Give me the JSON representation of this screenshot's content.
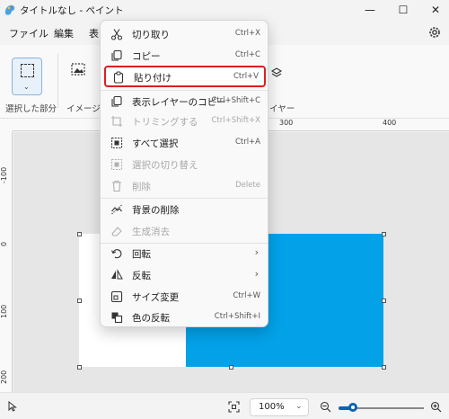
{
  "window": {
    "title": "タイトルなし - ペイント",
    "minimize": "—",
    "maximize": "☐",
    "close": "✕"
  },
  "menubar": {
    "items": [
      "ファイル",
      "編集",
      "表"
    ]
  },
  "ribbon": {
    "selection_label": "選択した部分",
    "image_label": "イメージ",
    "layers_label": "イヤー"
  },
  "rulers": {
    "top": [
      "300",
      "400"
    ],
    "left": [
      "-100",
      "0",
      "100",
      "200"
    ]
  },
  "context_menu": {
    "items": [
      {
        "label": "切り取り",
        "shortcut": "Ctrl+X",
        "icon": "scissors-icon",
        "enabled": true
      },
      {
        "label": "コピー",
        "shortcut": "Ctrl+C",
        "icon": "copy-icon",
        "enabled": true
      },
      {
        "label": "貼り付け",
        "shortcut": "Ctrl+V",
        "icon": "paste-icon",
        "enabled": true,
        "highlighted": true
      },
      {
        "label": "表示レイヤーのコピー",
        "shortcut": "Ctrl+Shift+C",
        "icon": "copy-layer-icon",
        "enabled": true
      },
      {
        "label": "トリミングする",
        "shortcut": "Ctrl+Shift+X",
        "icon": "crop-icon",
        "enabled": false
      },
      {
        "label": "すべて選択",
        "shortcut": "Ctrl+A",
        "icon": "select-all-icon",
        "enabled": true
      },
      {
        "label": "選択の切り替え",
        "shortcut": "",
        "icon": "invert-selection-icon",
        "enabled": false
      },
      {
        "label": "削除",
        "shortcut": "Delete",
        "icon": "trash-icon",
        "enabled": false
      },
      {
        "label": "背景の削除",
        "shortcut": "",
        "icon": "remove-background-icon",
        "enabled": true
      },
      {
        "label": "生成消去",
        "shortcut": "",
        "icon": "generative-erase-icon",
        "enabled": false
      },
      {
        "label": "回転",
        "shortcut": "",
        "icon": "rotate-icon",
        "enabled": true,
        "submenu": true
      },
      {
        "label": "反転",
        "shortcut": "",
        "icon": "flip-icon",
        "enabled": true,
        "submenu": true
      },
      {
        "label": "サイズ変更",
        "shortcut": "Ctrl+W",
        "icon": "resize-icon",
        "enabled": true
      },
      {
        "label": "色の反転",
        "shortcut": "Ctrl+Shift+I",
        "icon": "invert-color-icon",
        "enabled": true
      }
    ]
  },
  "status": {
    "zoom": "100%"
  },
  "colors": {
    "shape_fill": "#03a1e8",
    "highlight_border": "#e01d1d",
    "accent": "#0b63b5"
  }
}
